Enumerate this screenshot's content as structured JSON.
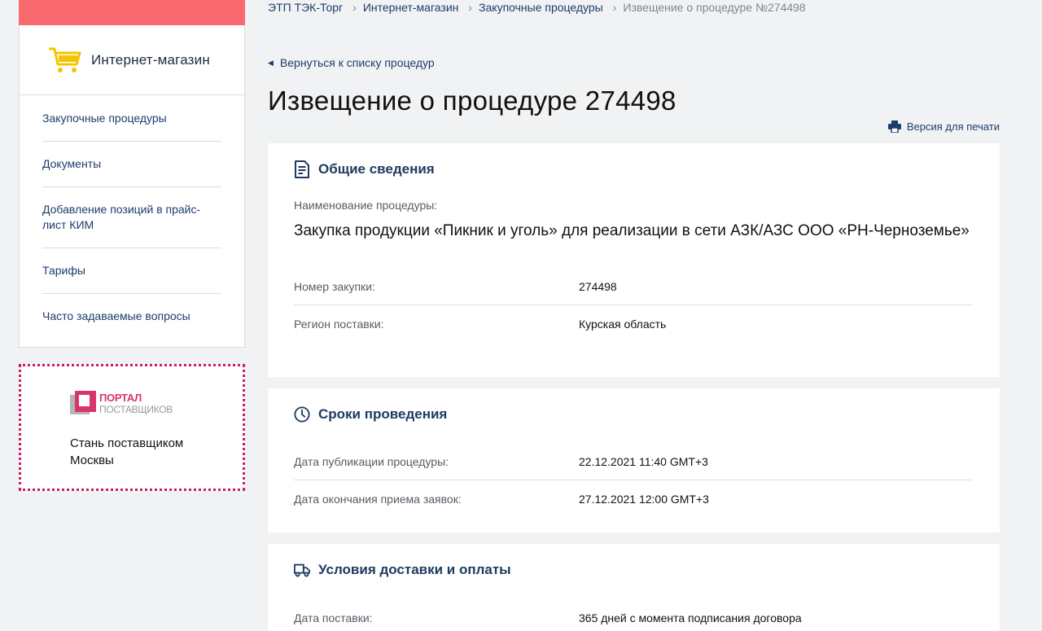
{
  "sidebar": {
    "logo_text": "Интернет-магазин",
    "nav": [
      {
        "label": "Закупочные процедуры"
      },
      {
        "label": "Документы"
      },
      {
        "label": "Добавление позиций в прайс-лист КИМ"
      },
      {
        "label": "Тарифы"
      },
      {
        "label": "Часто задаваемые вопросы"
      }
    ],
    "promo": {
      "portal_title": "ПОРТАЛ",
      "portal_subtitle": "ПОСТАВЩИКОВ",
      "text": "Стань поставщиком Москвы"
    }
  },
  "breadcrumb": {
    "items": [
      "ЭТП ТЭК-Торг",
      "Интернет-магазин",
      "Закупочные процедуры"
    ],
    "current": "Извещение о процедуре №274498",
    "separator": "›"
  },
  "back_link": "Вернуться к списку процедур",
  "page_title": "Извещение о процедуре 274498",
  "print_link": "Версия для печати",
  "general": {
    "title": "Общие сведения",
    "name_label": "Наименование процедуры:",
    "name_value": "Закупка продукции «Пикник и уголь» для реализации в сети АЗК/АЗС ООО «РН-Черноземье»",
    "rows": [
      {
        "label": "Номер закупки:",
        "value": "274498"
      },
      {
        "label": "Регион поставки:",
        "value": "Курская область"
      }
    ]
  },
  "terms": {
    "title": "Сроки проведения",
    "rows": [
      {
        "label": "Дата публикации процедуры:",
        "value": "22.12.2021 11:40 GMT+3"
      },
      {
        "label": "Дата окончания приема заявок:",
        "value": "27.12.2021 12:00 GMT+3"
      }
    ]
  },
  "delivery": {
    "title": "Условия доставки и оплаты",
    "rows": [
      {
        "label": "Дата поставки:",
        "value": "365 дней с момента подписания договора"
      }
    ]
  },
  "colors": {
    "accent_red": "#f86a6e",
    "link_blue": "#1c3d6b",
    "promo_border": "#d2186a",
    "cart_yellow": "#f5c400"
  }
}
